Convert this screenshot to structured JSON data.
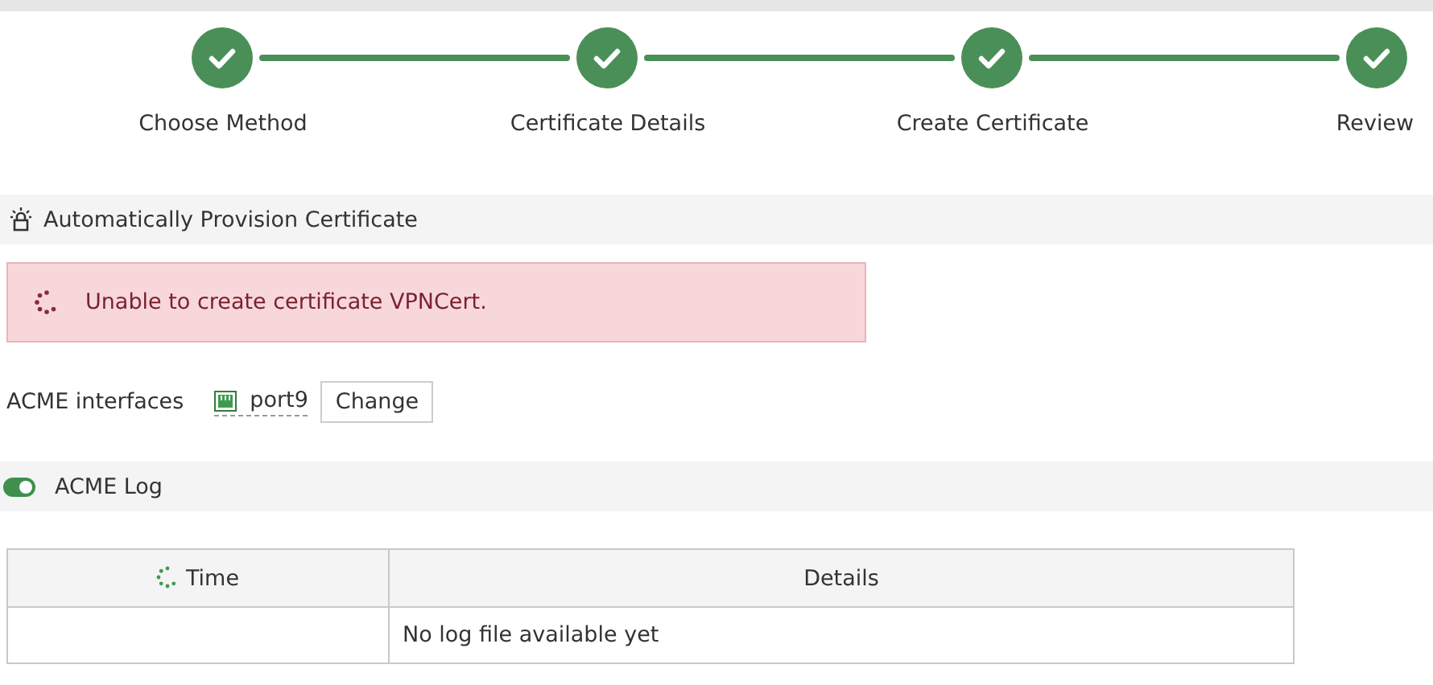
{
  "steps": [
    {
      "label": "Choose Method",
      "done": true
    },
    {
      "label": "Certificate Details",
      "done": true
    },
    {
      "label": "Create Certificate",
      "done": true
    },
    {
      "label": "Review",
      "done": true
    }
  ],
  "section": {
    "title": "Automatically Provision Certificate"
  },
  "error": {
    "message": "Unable to create certificate VPNCert."
  },
  "interfaces": {
    "label": "ACME interfaces",
    "port": "port9",
    "button": "Change"
  },
  "log": {
    "title": "ACME Log",
    "on": true
  },
  "table": {
    "columns": [
      "Time",
      "Details"
    ],
    "rows": [
      [
        "",
        "No log file available yet"
      ]
    ]
  }
}
